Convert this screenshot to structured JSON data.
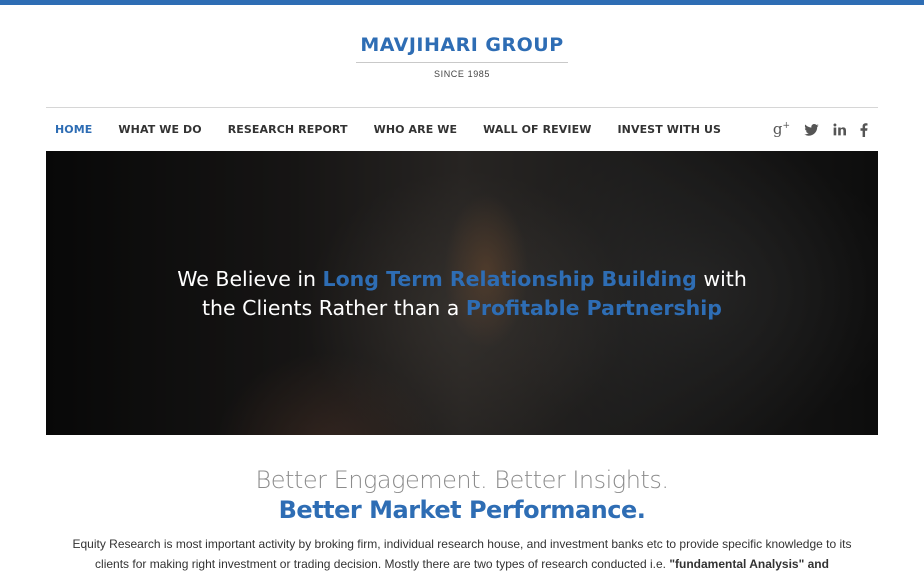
{
  "brand": {
    "name": "MAVJIHARI GROUP",
    "since": "SINCE 1985",
    "accent": "#2e6db4"
  },
  "nav": {
    "items": [
      {
        "label": "HOME",
        "active": true
      },
      {
        "label": "WHAT WE DO"
      },
      {
        "label": "RESEARCH REPORT"
      },
      {
        "label": "WHO ARE WE"
      },
      {
        "label": "WALL OF REVIEW"
      },
      {
        "label": "INVEST WITH US"
      }
    ],
    "social": [
      "google-plus-icon",
      "twitter-icon",
      "linkedin-icon",
      "facebook-icon"
    ]
  },
  "hero": {
    "part1": "We Believe in ",
    "highlight1": "Long Term Relationship Building",
    "part2": " with",
    "part3": "the Clients Rather than a ",
    "highlight2": "Profitable Partnership"
  },
  "intro": {
    "tagline": "Better Engagement. Better Insights.",
    "headline": "Better Market Performance.",
    "body_before": "Equity Research is most important activity by broking firm, individual research house, and investment banks etc to provide specific knowledge to its clients for making right investment or trading decision. Mostly there are two types of research conducted i.e. ",
    "body_bold": "\"fundamental Analysis\" and \"Technical Analysis\""
  }
}
